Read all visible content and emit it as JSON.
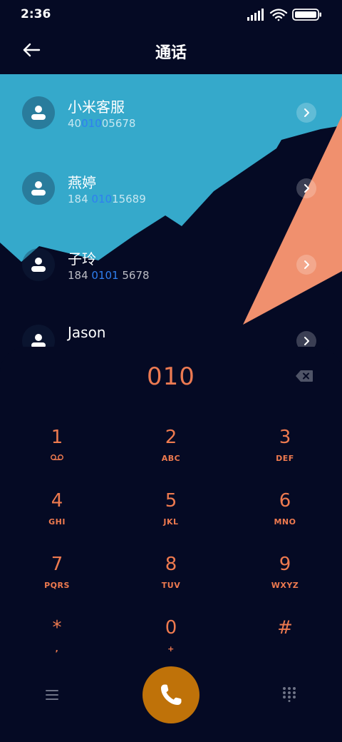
{
  "status_bar": {
    "time": "2:36"
  },
  "header": {
    "title": "通话"
  },
  "contacts": [
    {
      "name": "小米客服",
      "number_parts": [
        "40",
        "010",
        "05678"
      ]
    },
    {
      "name": "燕婷",
      "number_parts": [
        "184 ",
        "010",
        "15689"
      ]
    },
    {
      "name": "子玲",
      "number_parts": [
        "184 ",
        "0101",
        " 5678"
      ]
    },
    {
      "name": "Jason",
      "number_parts": [
        "",
        "",
        ""
      ]
    }
  ],
  "dialer": {
    "input": "010",
    "keys": [
      {
        "digit": "1",
        "letters": "",
        "icon": "voicemail-icon"
      },
      {
        "digit": "2",
        "letters": "ABC"
      },
      {
        "digit": "3",
        "letters": "DEF"
      },
      {
        "digit": "4",
        "letters": "GHI"
      },
      {
        "digit": "5",
        "letters": "JKL"
      },
      {
        "digit": "6",
        "letters": "MNO"
      },
      {
        "digit": "7",
        "letters": "PQRS"
      },
      {
        "digit": "8",
        "letters": "TUV"
      },
      {
        "digit": "9",
        "letters": "WXYZ"
      },
      {
        "digit": "*",
        "letters": ","
      },
      {
        "digit": "0",
        "letters": "+"
      },
      {
        "digit": "#",
        "letters": ""
      }
    ]
  },
  "colors": {
    "background": "#050a24",
    "wave": "#35a9cb",
    "triangle": "#f0906e",
    "accent_digits": "#ee7a4f",
    "number_highlight": "#2f7ff0",
    "call_button": "#bf7209"
  },
  "icons": {
    "back": "arrow-left-icon",
    "chevron": "chevron-right-icon",
    "avatar": "person-icon",
    "backspace": "backspace-icon",
    "menu": "menu-icon",
    "call": "phone-icon",
    "keypad": "dialpad-icon",
    "signal": "signal-icon",
    "wifi": "wifi-icon",
    "battery": "battery-icon"
  }
}
